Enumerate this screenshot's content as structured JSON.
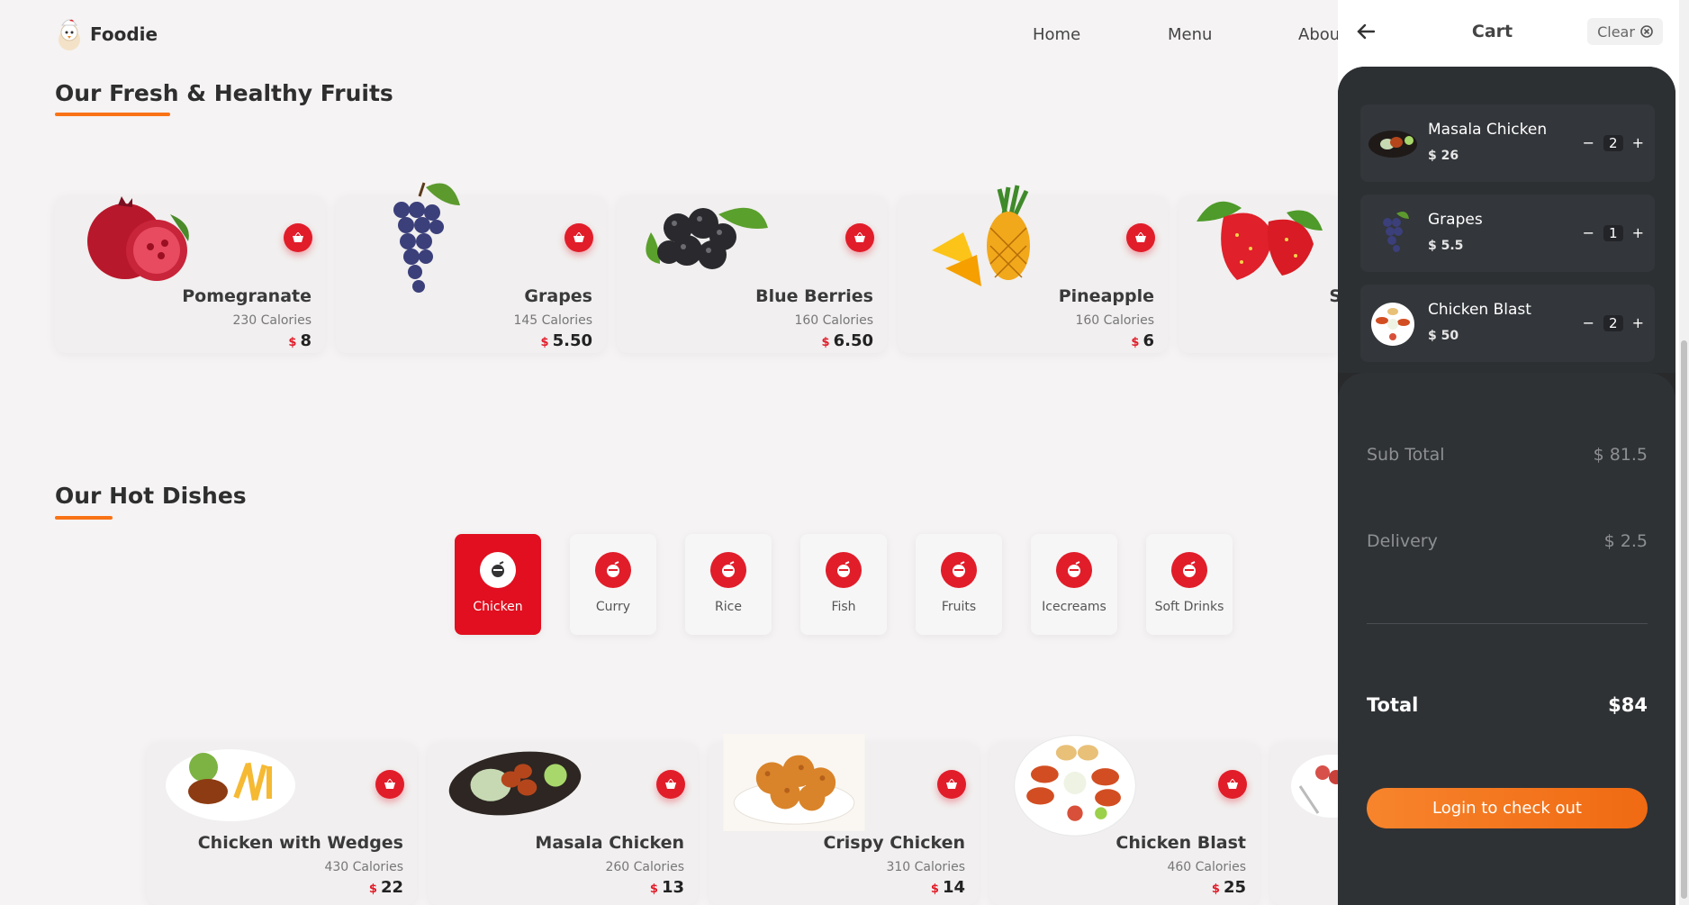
{
  "brand": {
    "name": "Foodie"
  },
  "nav": {
    "home": "Home",
    "menu": "Menu",
    "about": "Abou"
  },
  "fruits_section": {
    "title": "Our Fresh & Healthy Fruits",
    "items": [
      {
        "name": "Pomegranate",
        "calories": "230 Calories",
        "currency": "$",
        "price": "8"
      },
      {
        "name": "Grapes",
        "calories": "145 Calories",
        "currency": "$",
        "price": "5.50"
      },
      {
        "name": "Blue Berries",
        "calories": "160 Calories",
        "currency": "$",
        "price": "6.50"
      },
      {
        "name": "Pineapple",
        "calories": "160 Calories",
        "currency": "$",
        "price": "6"
      },
      {
        "name": "S"
      }
    ]
  },
  "dishes_section": {
    "title": "Our Hot Dishes",
    "categories": [
      {
        "label": "Chicken",
        "active": true
      },
      {
        "label": "Curry"
      },
      {
        "label": "Rice"
      },
      {
        "label": "Fish"
      },
      {
        "label": "Fruits"
      },
      {
        "label": "Icecreams"
      },
      {
        "label": "Soft Drinks"
      }
    ],
    "items": [
      {
        "name": "Chicken with Wedges",
        "calories": "430 Calories",
        "currency": "$",
        "price": "22"
      },
      {
        "name": "Masala Chicken",
        "calories": "260 Calories",
        "currency": "$",
        "price": "13"
      },
      {
        "name": "Crispy Chicken",
        "calories": "310 Calories",
        "currency": "$",
        "price": "14"
      },
      {
        "name": "Chicken Blast",
        "calories": "460 Calories",
        "currency": "$",
        "price": "25"
      }
    ]
  },
  "cart": {
    "title": "Cart",
    "clear_label": "Clear",
    "items": [
      {
        "name": "Masala Chicken",
        "price": "$ 26",
        "qty": "2"
      },
      {
        "name": "Grapes",
        "price": "$ 5.5",
        "qty": "1"
      },
      {
        "name": "Chicken Blast",
        "price": "$ 50",
        "qty": "2"
      }
    ],
    "subtotal_label": "Sub Total",
    "subtotal_value": "$ 81.5",
    "delivery_label": "Delivery",
    "delivery_value": "$ 2.5",
    "total_label": "Total",
    "total_value": "$84",
    "checkout_label": "Login to check out",
    "minus": "−",
    "plus": "+"
  },
  "colors": {
    "accent": "#e11d2a",
    "orange": "#f97316",
    "cart_dark": "#282a2c"
  }
}
